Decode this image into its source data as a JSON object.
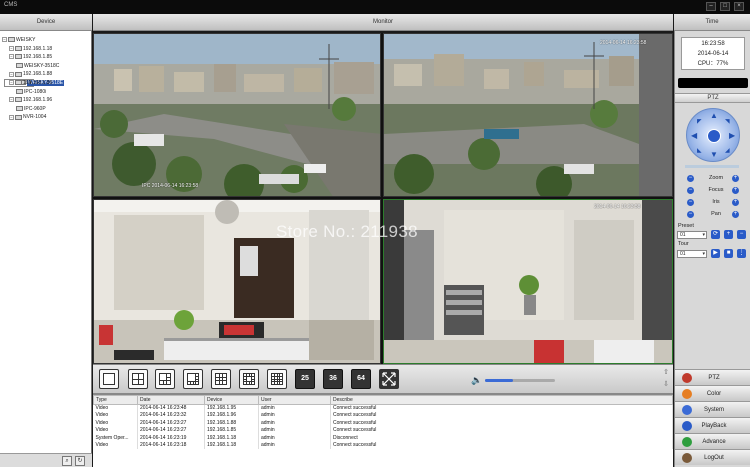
{
  "window": {
    "title": "CMS",
    "controls": [
      "–",
      "□",
      "×"
    ]
  },
  "headers": {
    "device": "Device",
    "monitor": "Monitor",
    "time": "Time"
  },
  "device_tree": [
    {
      "label": "WEISKY",
      "level": 0,
      "selected": false
    },
    {
      "label": "192.168.1.18",
      "level": 1,
      "selected": false
    },
    {
      "label": "192.168.1.85",
      "level": 1,
      "selected": false
    },
    {
      "label": "WEISKY-3518C",
      "level": 2,
      "selected": false
    },
    {
      "label": "192.168.1.88",
      "level": 1,
      "selected": false
    },
    {
      "label": "WEISKY-3518E",
      "level": 2,
      "selected": true
    },
    {
      "label": "192.168.1.95",
      "level": 1,
      "selected": false
    },
    {
      "label": "IPC-1080i",
      "level": 2,
      "selected": false
    },
    {
      "label": "192.168.1.96",
      "level": 1,
      "selected": false
    },
    {
      "label": "IPC-960P",
      "level": 2,
      "selected": false
    },
    {
      "label": "NVR-1004",
      "level": 1,
      "selected": false
    }
  ],
  "cameras": [
    {
      "osd": "IPC 2014-06-14 16:23:58",
      "scene": "city"
    },
    {
      "osd": "2014-06-14 16:23:58",
      "scene": "city"
    },
    {
      "osd": "",
      "scene": "office"
    },
    {
      "osd": "2014-06-14 16:23:58",
      "scene": "office2"
    }
  ],
  "watermark": "Store No.: 211938",
  "grid_buttons": [
    "1",
    "4",
    "6",
    "8",
    "9",
    "13",
    "16",
    "25",
    "36",
    "64"
  ],
  "volume_level": 0.4,
  "log": {
    "columns": [
      "Type",
      "Date",
      "Device",
      "User",
      "Describe"
    ],
    "rows": [
      [
        "Video",
        "2014-06-14 16:23:48",
        "192.168.1.95",
        "admin",
        "Connect successful"
      ],
      [
        "Video",
        "2014-06-14 16:23:32",
        "192.168.1.96",
        "admin",
        "Connect successful"
      ],
      [
        "Video",
        "2014-06-14 16:23:27",
        "192.168.1.88",
        "admin",
        "Connect successful"
      ],
      [
        "Video",
        "2014-06-14 16:23:27",
        "192.168.1.85",
        "admin",
        "Connect successful"
      ],
      [
        "System Oper...",
        "2014-06-14 16:23:19",
        "192.168.1.18",
        "admin",
        "Disconnect"
      ],
      [
        "Video",
        "2014-06-14 16:23:18",
        "192.168.1.18",
        "admin",
        "Connect successful"
      ]
    ]
  },
  "clock": {
    "time": "16:23:58",
    "date": "2014-06-14",
    "cpu": "CPU：77%"
  },
  "ptz": {
    "label": "PTZ",
    "controls": [
      "Zoom",
      "Focus",
      "Iris",
      "Pan"
    ],
    "preset_label": "Preset",
    "preset_value": "01",
    "tour_label": "Tour",
    "tour_value": "01"
  },
  "menu": [
    {
      "label": "PTZ",
      "icon": "ptz-icon",
      "color": "#c0392b"
    },
    {
      "label": "Color",
      "icon": "color-icon",
      "color": "#e67e22"
    },
    {
      "label": "System",
      "icon": "system-icon",
      "color": "#3b6bd6"
    },
    {
      "label": "PlayBack",
      "icon": "playback-icon",
      "color": "#2a5bc8"
    },
    {
      "label": "Advance",
      "icon": "advance-icon",
      "color": "#2e9e3e"
    },
    {
      "label": "LogOut",
      "icon": "logout-icon",
      "color": "#7a5a3a"
    }
  ],
  "colors": {
    "selection": "#2a55a8",
    "accent": "#2a5bc8"
  }
}
